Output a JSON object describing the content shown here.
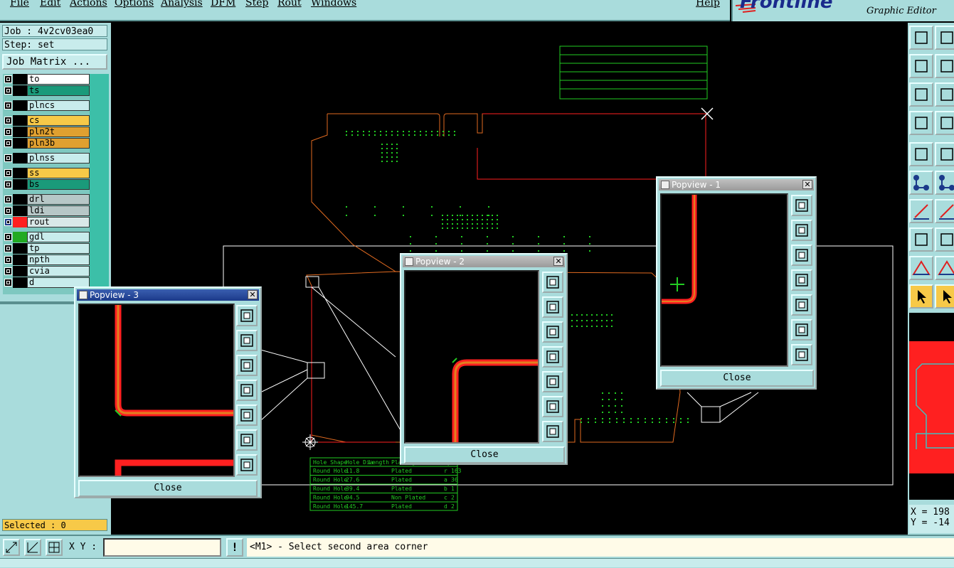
{
  "menu": {
    "items": [
      "File",
      "Edit",
      "Actions",
      "Options",
      "Analysis",
      "DFM",
      "Step",
      "Rout",
      "Windows"
    ],
    "help": "Help"
  },
  "brand": {
    "logo": "Frontline",
    "subtitle": "Graphic Editor"
  },
  "job": {
    "job_line": "Job : 4v2cv03ea0",
    "step_line": "Step: set",
    "matrix_button": "Job Matrix ..."
  },
  "layers": [
    {
      "name": "to",
      "color": "#ffffff"
    },
    {
      "name": "ts",
      "color": "#1a9a7a"
    },
    {
      "name": "plncs",
      "color": "#c8ecec"
    },
    {
      "name": "cs",
      "color": "#f7c948"
    },
    {
      "name": "pln2t",
      "color": "#e0a030"
    },
    {
      "name": "pln3b",
      "color": "#e0a030"
    },
    {
      "name": "plnss",
      "color": "#c8ecec"
    },
    {
      "name": "ss",
      "color": "#f7c948"
    },
    {
      "name": "bs",
      "color": "#1a9a7a"
    },
    {
      "name": "drl",
      "color": "#b7c7c7"
    },
    {
      "name": "ldi",
      "color": "#b7c7c7"
    },
    {
      "name": "rout",
      "color": "#d9e8e8"
    },
    {
      "name": "gdl",
      "color": "#c8ecec"
    },
    {
      "name": "tp",
      "color": "#c8ecec"
    },
    {
      "name": "npth",
      "color": "#c8ecec"
    },
    {
      "name": "cvia",
      "color": "#c8ecec"
    },
    {
      "name": "d",
      "color": "#c8ecec"
    }
  ],
  "selected": "Selected : 0",
  "status": {
    "xy_label": "X Y :",
    "xy_value": "",
    "prompt": "<M1> - Select second area corner",
    "warn": "!"
  },
  "coords": {
    "x": "X = 198",
    "y": "Y = -14"
  },
  "drill_table": {
    "headers": [
      "Hole Shape",
      "Hole Dia",
      "Length",
      "Plating",
      "Sym",
      "Total"
    ],
    "rows": [
      [
        "Round Hole",
        "11.8",
        "",
        "Plated",
        "r",
        "163"
      ],
      [
        "Round Hole",
        "27.6",
        "",
        "Plated",
        "a",
        "36"
      ],
      [
        "Round Hole",
        "39.4",
        "",
        "Plated",
        "b",
        "1"
      ],
      [
        "Round Hole",
        "94.5",
        "",
        "Non Plated",
        "c",
        "2"
      ],
      [
        "Round Hole",
        "145.7",
        "",
        "Plated",
        "d",
        "2"
      ]
    ]
  },
  "popviews": [
    {
      "title": "Popview - 1",
      "close": "Close"
    },
    {
      "title": "Popview - 2",
      "close": "Close"
    },
    {
      "title": "Popview - 3",
      "close": "Close"
    }
  ],
  "icons": {
    "pop_tools": [
      "zoom-fit-icon",
      "pan-up-icon",
      "pan-down-icon",
      "pan-left-icon",
      "pan-right-icon",
      "zoom-in-icon",
      "zoom-out-icon"
    ],
    "status": [
      "measure-icon",
      "snap-icon",
      "grid-icon"
    ]
  },
  "colors": {
    "panel": "#a9dcdc",
    "rout": "#ff2020",
    "outline": "#ff6a20",
    "pads": "#22cc22",
    "copper_trace": "#cc5a20"
  }
}
